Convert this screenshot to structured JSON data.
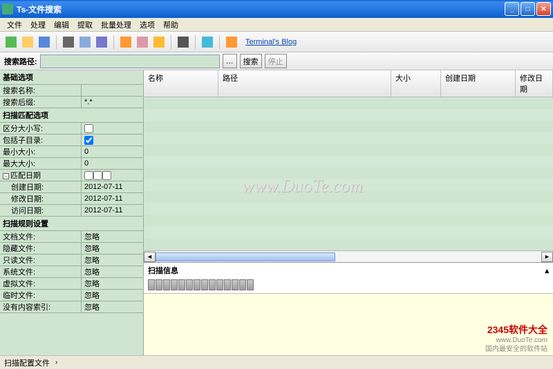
{
  "window": {
    "title": "Ts-文件搜索"
  },
  "menu": {
    "file": "文件",
    "process": "处理",
    "edit": "编辑",
    "extract": "提取",
    "batch": "批量处理",
    "options": "选项",
    "help": "帮助"
  },
  "toolbar": {
    "link": "Terminal's Blog"
  },
  "pathbar": {
    "label": "搜索路径:",
    "browse": "…",
    "search": "搜索",
    "stop": "停止"
  },
  "sidebar": {
    "basic_header": "基础选项",
    "search_name_lbl": "搜索名称:",
    "search_ext_lbl": "搜索后缀:",
    "search_ext_val": "*.*",
    "scan_match_header": "扫描匹配选项",
    "case_lbl": "区分大小写:",
    "subdir_lbl": "包括子目录:",
    "min_size_lbl": "最小大小:",
    "min_size_val": "0",
    "max_size_lbl": "最大大小:",
    "max_size_val": "0",
    "match_date_lbl": "匹配日期",
    "create_date_lbl": "创建日期:",
    "create_date_val": "2012-07-11",
    "modify_date_lbl": "修改日期:",
    "modify_date_val": "2012-07-11",
    "access_date_lbl": "访问日期:",
    "access_date_val": "2012-07-11",
    "rules_header": "扫描规则设置",
    "docfile_lbl": "文档文件:",
    "docfile_val": "忽略",
    "hidden_lbl": "隐藏文件:",
    "hidden_val": "忽略",
    "readonly_lbl": "只读文件:",
    "readonly_val": "忽略",
    "system_lbl": "系统文件:",
    "system_val": "忽略",
    "virtual_lbl": "虚拟文件:",
    "virtual_val": "忽略",
    "temp_lbl": "临时文件:",
    "temp_val": "忽略",
    "nocontent_lbl": "没有内容索引:",
    "nocontent_val": "忽略"
  },
  "grid": {
    "col_name": "名称",
    "col_path": "路径",
    "col_size": "大小",
    "col_created": "创建日期",
    "col_modified": "修改日期"
  },
  "scan_info": {
    "label": "扫描信息"
  },
  "status": {
    "text": "扫描配置文件"
  },
  "watermark": "www.DuoTe.com",
  "badge": {
    "brand": "2345软件大全",
    "url": "www.DuoTe.com",
    "slogan": "国内最安全的软件站"
  }
}
